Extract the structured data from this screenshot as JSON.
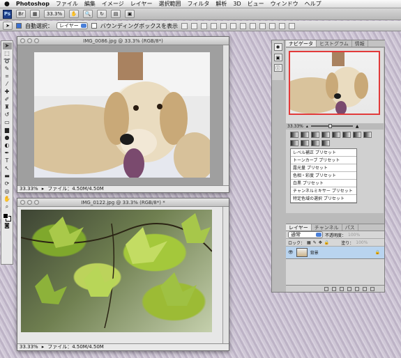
{
  "menubar": {
    "apple": "",
    "items": [
      "Photoshop",
      "ファイル",
      "編集",
      "イメージ",
      "レイヤー",
      "選択範囲",
      "フィルタ",
      "解析",
      "3D",
      "ビュー",
      "ウィンドウ",
      "ヘルプ"
    ]
  },
  "appbar": {
    "logo": "Ps",
    "zoom": "33.3%"
  },
  "options": {
    "auto_select_label": "自動選択：",
    "auto_select_value": "レイヤー",
    "bbox_label": "バウンディングボックスを表示"
  },
  "doc1": {
    "title": "IMG_0086.jpg @ 33.3% (RGB/8*)",
    "zoom": "33.33%",
    "file_info": "ファイル：4.50M/4.50M"
  },
  "doc2": {
    "title": "IMG_0122.jpg @ 33.3% (RGB/8*) *",
    "zoom": "33.33%",
    "file_info": "ファイル：4.50M/4.50M"
  },
  "navigator": {
    "tabs": [
      "ナビゲータ",
      "ヒストグラム",
      "情報"
    ],
    "zoom": "33.33%"
  },
  "adjustments": {
    "presets": [
      "レベル補正 プリセット",
      "トーンカーブ プリセット",
      "露光量 プリセット",
      "色相・彩度 プリセット",
      "白黒 プリセット",
      "チャンネルミキサー プリセット",
      "特定色域の選択 プリセット"
    ]
  },
  "layers": {
    "tabs": [
      "レイヤー",
      "チャンネル",
      "パス"
    ],
    "blend_mode": "通常",
    "opacity_label": "不透明度：",
    "opacity_value": "100%",
    "lock_label": "ロック：",
    "fill_label": "塗り：",
    "fill_value": "100%",
    "layer_name": "背景"
  },
  "colors": {
    "accent_blue": "#3a6fd0",
    "nav_frame": "#e23a3a",
    "selected_layer": "#b9d4ef"
  }
}
